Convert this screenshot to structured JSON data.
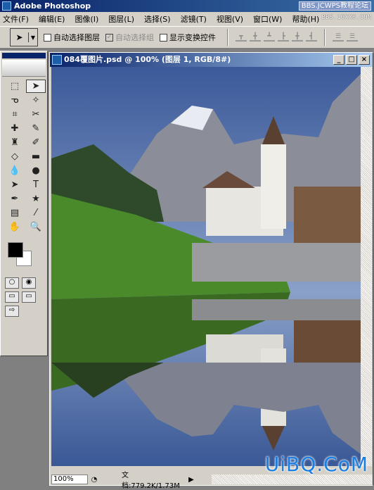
{
  "app": {
    "title": "Adobe Photoshop"
  },
  "watermarks": {
    "top": "BBS.JCWPS教程论坛",
    "top2": "BBS.16XX8.COM",
    "bottom": "UiBQ.CoM"
  },
  "menu": [
    "文件(F)",
    "编辑(E)",
    "图像(I)",
    "图层(L)",
    "选择(S)",
    "滤镜(T)",
    "视图(V)",
    "窗口(W)",
    "帮助(H)"
  ],
  "options": {
    "auto_select_layer": "自动选择图层",
    "auto_select_group": "自动选择组",
    "show_transform": "显示变换控件",
    "auto_select_layer_checked": false,
    "auto_select_group_checked": true,
    "show_transform_checked": false
  },
  "document": {
    "title": "084覆图片.psd @ 100% (图层 1, RGB/8#)",
    "zoom": "100%",
    "info": "文档:779.2K/1.73M"
  },
  "window_buttons": {
    "minimize": "_",
    "maximize": "□",
    "close": "×"
  },
  "colors": {
    "foreground": "#000000",
    "background": "#ffffff",
    "title_bar": "#0a246a"
  },
  "tools": [
    "marquee",
    "move",
    "lasso",
    "magic-wand",
    "crop",
    "slice",
    "healing",
    "brush",
    "stamp",
    "history-brush",
    "eraser",
    "gradient",
    "blur",
    "dodge",
    "path-select",
    "type",
    "pen",
    "shape",
    "notes",
    "eyedropper",
    "hand",
    "zoom"
  ]
}
